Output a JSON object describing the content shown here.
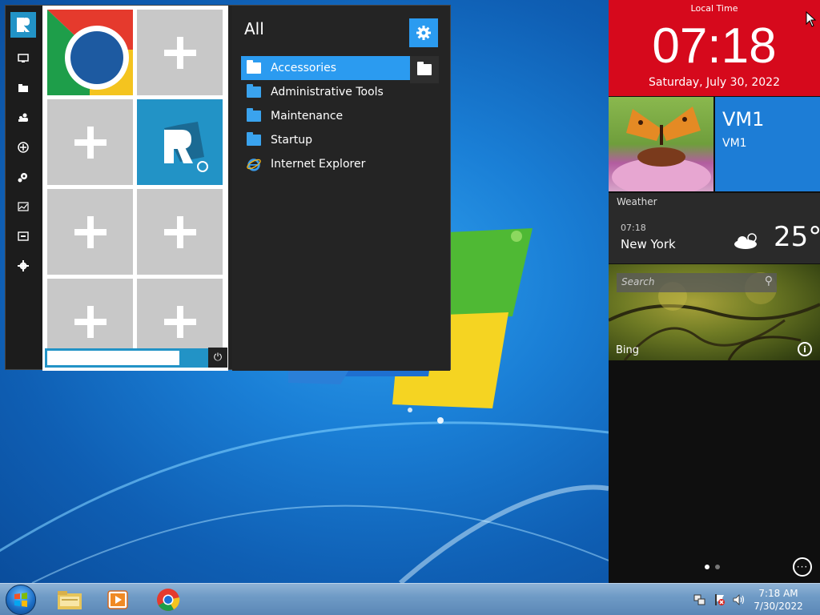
{
  "programs": {
    "title": "All",
    "items": [
      {
        "label": "Accessories",
        "icon": "folder-icon",
        "selected": true
      },
      {
        "label": "Administrative Tools",
        "icon": "folder-icon"
      },
      {
        "label": "Maintenance",
        "icon": "folder-icon"
      },
      {
        "label": "Startup",
        "icon": "folder-icon"
      },
      {
        "label": "Internet Explorer",
        "icon": "ie-icon"
      }
    ]
  },
  "sidebar": {
    "icons": [
      "this-pc-icon",
      "folder-icon",
      "users-icon",
      "network-icon",
      "control-panel-icon",
      "performance-icon",
      "run-icon",
      "settings-icon"
    ]
  },
  "tiles": {
    "apps": [
      "chrome-icon",
      "add-icon",
      "add-icon",
      "app-logo-icon",
      "add-icon",
      "add-icon",
      "add-icon",
      "add-icon"
    ]
  },
  "clock": {
    "caption": "Local Time",
    "time": "07:18",
    "date": "Saturday, July 30, 2022"
  },
  "user": {
    "name": "VM1",
    "subtitle": "VM1"
  },
  "weather": {
    "label": "Weather",
    "time": "07:18",
    "city": "New York",
    "temperature": "25°",
    "condition_icon": "cloudy-sun-icon"
  },
  "bing": {
    "search_placeholder": "Search",
    "label": "Bing",
    "info_glyph": "i"
  },
  "pager": {
    "pages": 2,
    "active": 1,
    "more_glyph": "···"
  },
  "taskbar": {
    "apps": [
      "file-explorer-icon",
      "media-player-icon",
      "chrome-icon"
    ],
    "tray_icons": [
      "network-icon",
      "action-center-icon",
      "volume-icon"
    ],
    "time": "7:18 AM",
    "date": "7/30/2022"
  },
  "colors": {
    "accent": "#2b9bf0",
    "clock_bg": "#d6091c",
    "user_tile_bg": "#1d7dd6",
    "menu_bg": "#242424"
  }
}
